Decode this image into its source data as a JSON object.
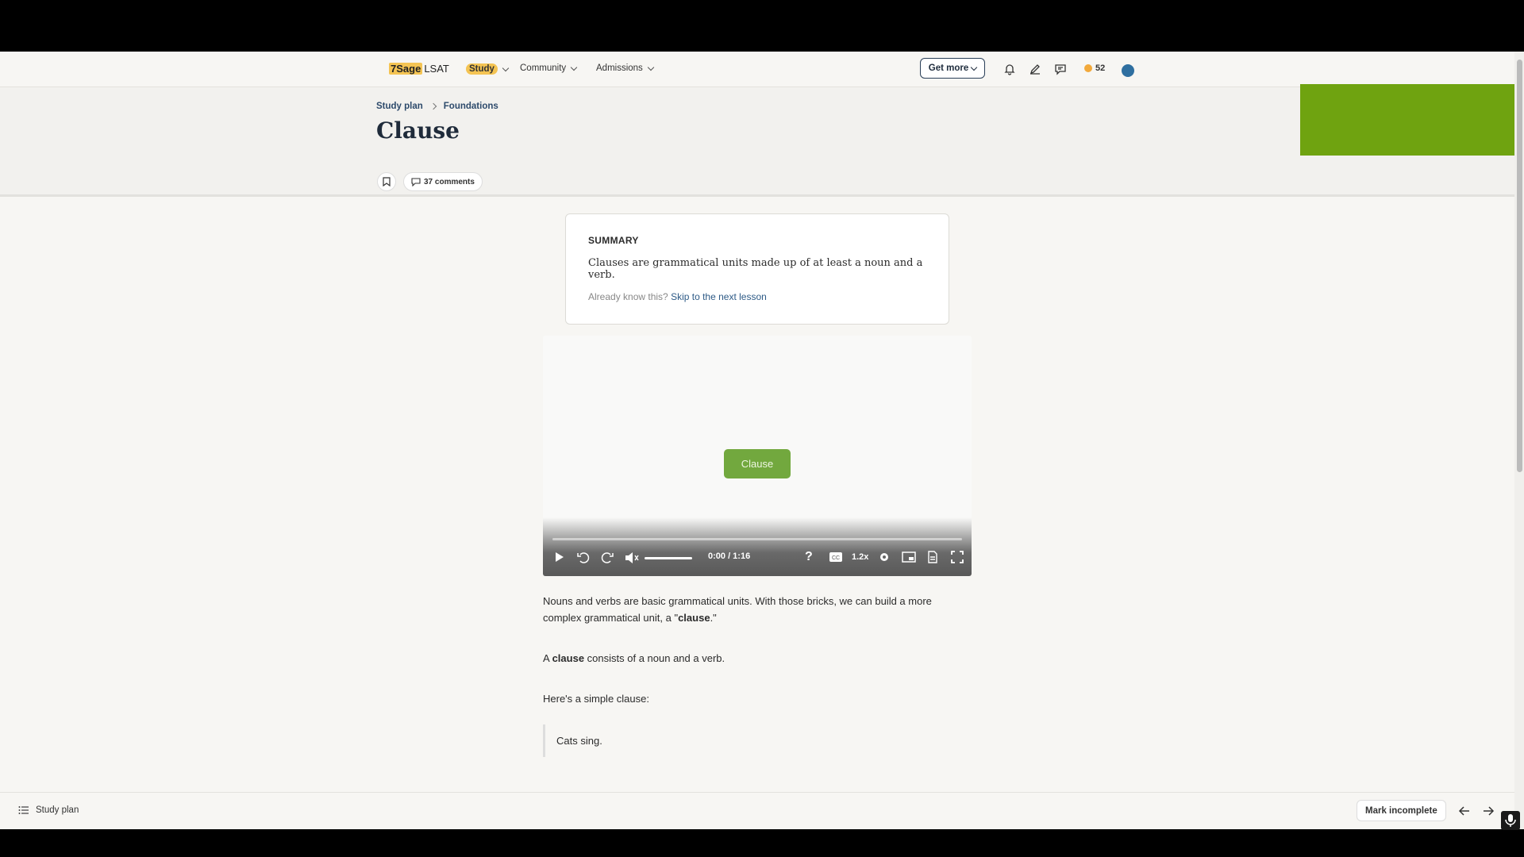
{
  "nav": {
    "brand_highlight": "7Sage",
    "brand_rest": "LSAT",
    "items": [
      {
        "label": "Study"
      },
      {
        "label": "Community"
      },
      {
        "label": "Admissions"
      }
    ],
    "get_more": "Get more",
    "coins": "52"
  },
  "breadcrumb": {
    "item1": "Study plan",
    "item2": "Foundations"
  },
  "page": {
    "title": "Clause",
    "comments": "37 comments"
  },
  "summary": {
    "heading": "SUMMARY",
    "body": "Clauses are grammatical units made up of at least a noun and a verb.",
    "skip_prefix": "Already know this?",
    "skip_link": "Skip to the next lesson"
  },
  "video": {
    "slide_label": "Clause",
    "time": "0:00 / 1:16",
    "speed": "1.2x",
    "progress": 0
  },
  "content": {
    "p1_a": "Nouns and verbs are basic grammatical units. With those bricks, we can build a more complex grammatical unit, a \"",
    "p1_bold": "clause",
    "p1_b": ".\"",
    "p2_a": "A ",
    "p2_bold": "clause",
    "p2_b": " consists of a noun and a verb.",
    "p3": "Here's a simple clause:",
    "quote": "Cats sing."
  },
  "bottom": {
    "study_plan": "Study plan",
    "mark_incomplete": "Mark incomplete"
  },
  "colors": {
    "accent_yellow": "#f4c453",
    "green_banner": "#6fa310",
    "slide_green": "#72a83e",
    "link_blue": "#2d5a86"
  }
}
